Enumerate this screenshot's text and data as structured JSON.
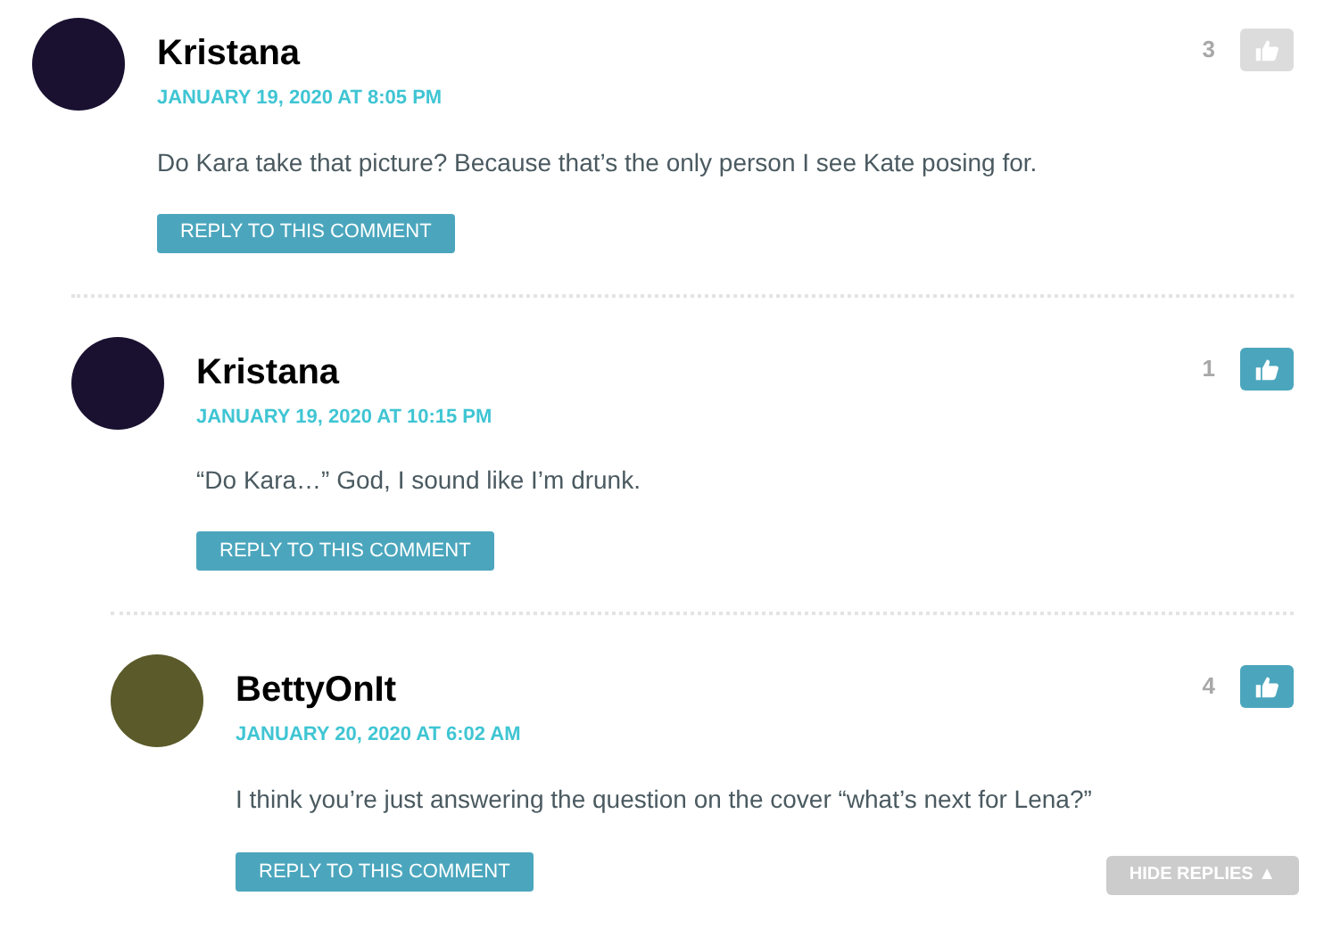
{
  "comments": [
    {
      "author": "Kristana",
      "color": "#1a1030",
      "date": "JANUARY 19, 2020 AT 8:05 PM",
      "text": "Do Kara take that picture? Because that’s the only person I see Kate posing for.",
      "likes": "3",
      "liked": false,
      "reply_button": "REPLY TO THIS COMMENT",
      "children": [
        {
          "author": "Kristana",
          "color": "#1a1030",
          "date": "JANUARY 19, 2020 AT 10:15 PM",
          "text": "“Do Kara…” God, I sound like I’m drunk.",
          "likes": "1",
          "liked": true,
          "reply_button": "REPLY TO THIS COMMENT",
          "children": [
            {
              "author": "BettyOnIt",
              "color": "#5a5a2a",
              "date": "JANUARY 20, 2020 AT 6:02 AM",
              "text": "I think you’re just answering the question on the cover “what’s next for Lena?”",
              "likes": "4",
              "liked": true,
              "reply_button": "REPLY TO THIS COMMENT",
              "hide_replies": "HIDE REPLIES ▲"
            }
          ]
        }
      ]
    }
  ]
}
